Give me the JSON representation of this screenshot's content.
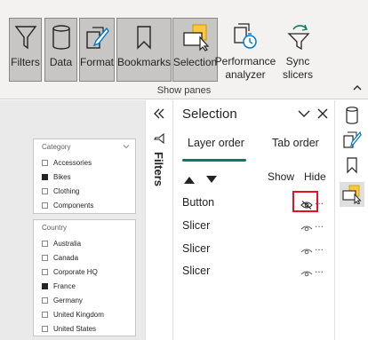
{
  "ribbon": {
    "buttons": [
      {
        "label": "Filters",
        "icon": "filter-funnel-icon",
        "pressed": true
      },
      {
        "label": "Data",
        "icon": "database-icon",
        "pressed": true
      },
      {
        "label": "Format",
        "icon": "format-paintbrush-icon",
        "pressed": true
      },
      {
        "label": "Bookmarks",
        "icon": "bookmark-icon",
        "pressed": true
      },
      {
        "label": "Selection",
        "icon": "selection-pane-icon",
        "pressed": true
      },
      {
        "label_line1": "Performance",
        "label_line2": "analyzer",
        "icon": "stopwatch-icon",
        "pressed": false
      },
      {
        "label_line1": "Sync",
        "label_line2": "slicers",
        "icon": "sync-slicers-icon",
        "pressed": false
      }
    ],
    "group_label": "Show panes"
  },
  "canvas": {
    "category_slicer": {
      "header": "Category",
      "items": [
        {
          "label": "Accessories",
          "checked": false
        },
        {
          "label": "Bikes",
          "checked": true
        },
        {
          "label": "Clothing",
          "checked": false
        },
        {
          "label": "Components",
          "checked": false
        }
      ]
    },
    "country_slicer": {
      "header": "Country",
      "items": [
        {
          "label": "Australia",
          "checked": false
        },
        {
          "label": "Canada",
          "checked": false
        },
        {
          "label": "Corporate HQ",
          "checked": false
        },
        {
          "label": "France",
          "checked": true
        },
        {
          "label": "Germany",
          "checked": false
        },
        {
          "label": "United Kingdom",
          "checked": false
        },
        {
          "label": "United States",
          "checked": false
        }
      ]
    }
  },
  "filters_pane": {
    "label": "Filters",
    "expand_icon": "double-chevron-left-icon"
  },
  "selection_pane": {
    "title": "Selection",
    "tabs": [
      "Layer order",
      "Tab order"
    ],
    "active_tab": "Layer order",
    "show_label": "Show",
    "hide_label": "Hide",
    "layers": [
      {
        "name": "Button",
        "visibility": "hidden"
      },
      {
        "name": "Slicer",
        "visibility": "visible"
      },
      {
        "name": "Slicer",
        "visibility": "visible"
      },
      {
        "name": "Slicer",
        "visibility": "visible"
      }
    ],
    "more_label": "...",
    "accent_color": "#117865",
    "highlight_color": "#e81123"
  },
  "right_strip": {
    "icons": [
      "database-icon",
      "format-paintbrush-icon",
      "bookmark-icon",
      "selection-pane-icon"
    ],
    "active": "selection-pane-icon"
  }
}
